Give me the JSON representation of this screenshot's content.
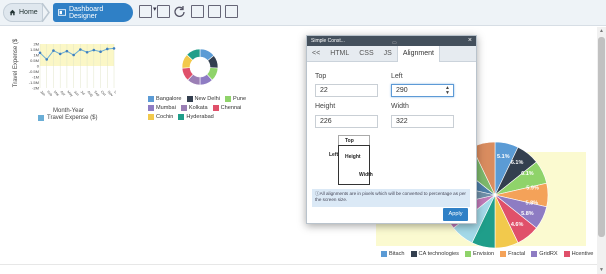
{
  "toolbar": {
    "home_label": "Home",
    "designer_label": "Dashboard Designer",
    "icons": [
      "layout-icon",
      "copy-icon",
      "refresh-icon",
      "filter-icon",
      "table-icon",
      "window-icon"
    ]
  },
  "line_chart": {
    "y_title": "Travel Expense ($",
    "x_title": "Month-Year",
    "legend_label": "Travel Expense ($)",
    "legend_color": "#6baed6",
    "y_ticks": [
      "2M",
      "1.5M",
      "1M",
      "0.5M",
      "0",
      "-0.5M",
      "-1M",
      "-1.5M",
      "-2M"
    ],
    "x_ticks": [
      "Jan",
      "Feb",
      "Mar",
      "Apr",
      "May",
      "Jun",
      "Jul",
      "Aug",
      "Sep",
      "Oct",
      "Nov",
      "Dec"
    ],
    "values": [
      1.2,
      0.6,
      1.4,
      1.1,
      1.35,
      1.0,
      1.5,
      1.25,
      1.45,
      1.3,
      1.55,
      1.6
    ],
    "ylim": [
      -2,
      2
    ]
  },
  "donut": {
    "legend": [
      {
        "label": "Bangalore",
        "color": "#5b9bd5"
      },
      {
        "label": "New Delhi",
        "color": "#333f4f"
      },
      {
        "label": "Pune",
        "color": "#8fd36a"
      },
      {
        "label": "Mumbai",
        "color": "#8e7cc3"
      },
      {
        "label": "Kolkata",
        "color": "#9b7fb5"
      },
      {
        "label": "Chennai",
        "color": "#e0506a"
      },
      {
        "label": "Cochin",
        "color": "#f2c94c"
      },
      {
        "label": "Hyderabad",
        "color": "#1f9e8a"
      }
    ],
    "values": [
      14,
      12,
      12,
      12,
      12,
      12,
      13,
      13
    ]
  },
  "pie": {
    "labels_on_slices": [
      "5.1%",
      "6.1%",
      "6.1%",
      "5.9%",
      "5.8%",
      "5.8%",
      "4.6%"
    ],
    "legend": [
      {
        "label": "Bitach",
        "color": "#5b9bd5"
      },
      {
        "label": "CA technologies",
        "color": "#333f4f"
      },
      {
        "label": "Envision",
        "color": "#8fd36a"
      },
      {
        "label": "Fractal",
        "color": "#f4a259"
      },
      {
        "label": "GridRX",
        "color": "#8e7cc3"
      },
      {
        "label": "Hcentive",
        "color": "#e0506a"
      }
    ],
    "slice_colors": [
      "#5b9bd5",
      "#333f4f",
      "#8fd36a",
      "#f4a259",
      "#8e7cc3",
      "#e0506a",
      "#f2c94c",
      "#1f9e8a",
      "#a3d9e8",
      "#c07ab8",
      "#6f8fa8",
      "#4d7ea8",
      "#7cb86b",
      "#d98c5f"
    ]
  },
  "dialog": {
    "title": "Simple Const...",
    "close": "×",
    "tabs": [
      "<<",
      "HTML",
      "CSS",
      "JS",
      "Alignment"
    ],
    "active_tab": "Alignment",
    "top_label": "Top",
    "top_value": "22",
    "left_label": "Left",
    "left_value": "290",
    "height_label": "Height",
    "height_value": "226",
    "width_label": "Width",
    "width_value": "322",
    "diagram": {
      "top": "Top",
      "left": "Left",
      "height": "Height",
      "width": "Width"
    },
    "info": "All alignments are in pixels which will be converted to percentage as per the screen size.",
    "apply_label": "Apply"
  }
}
